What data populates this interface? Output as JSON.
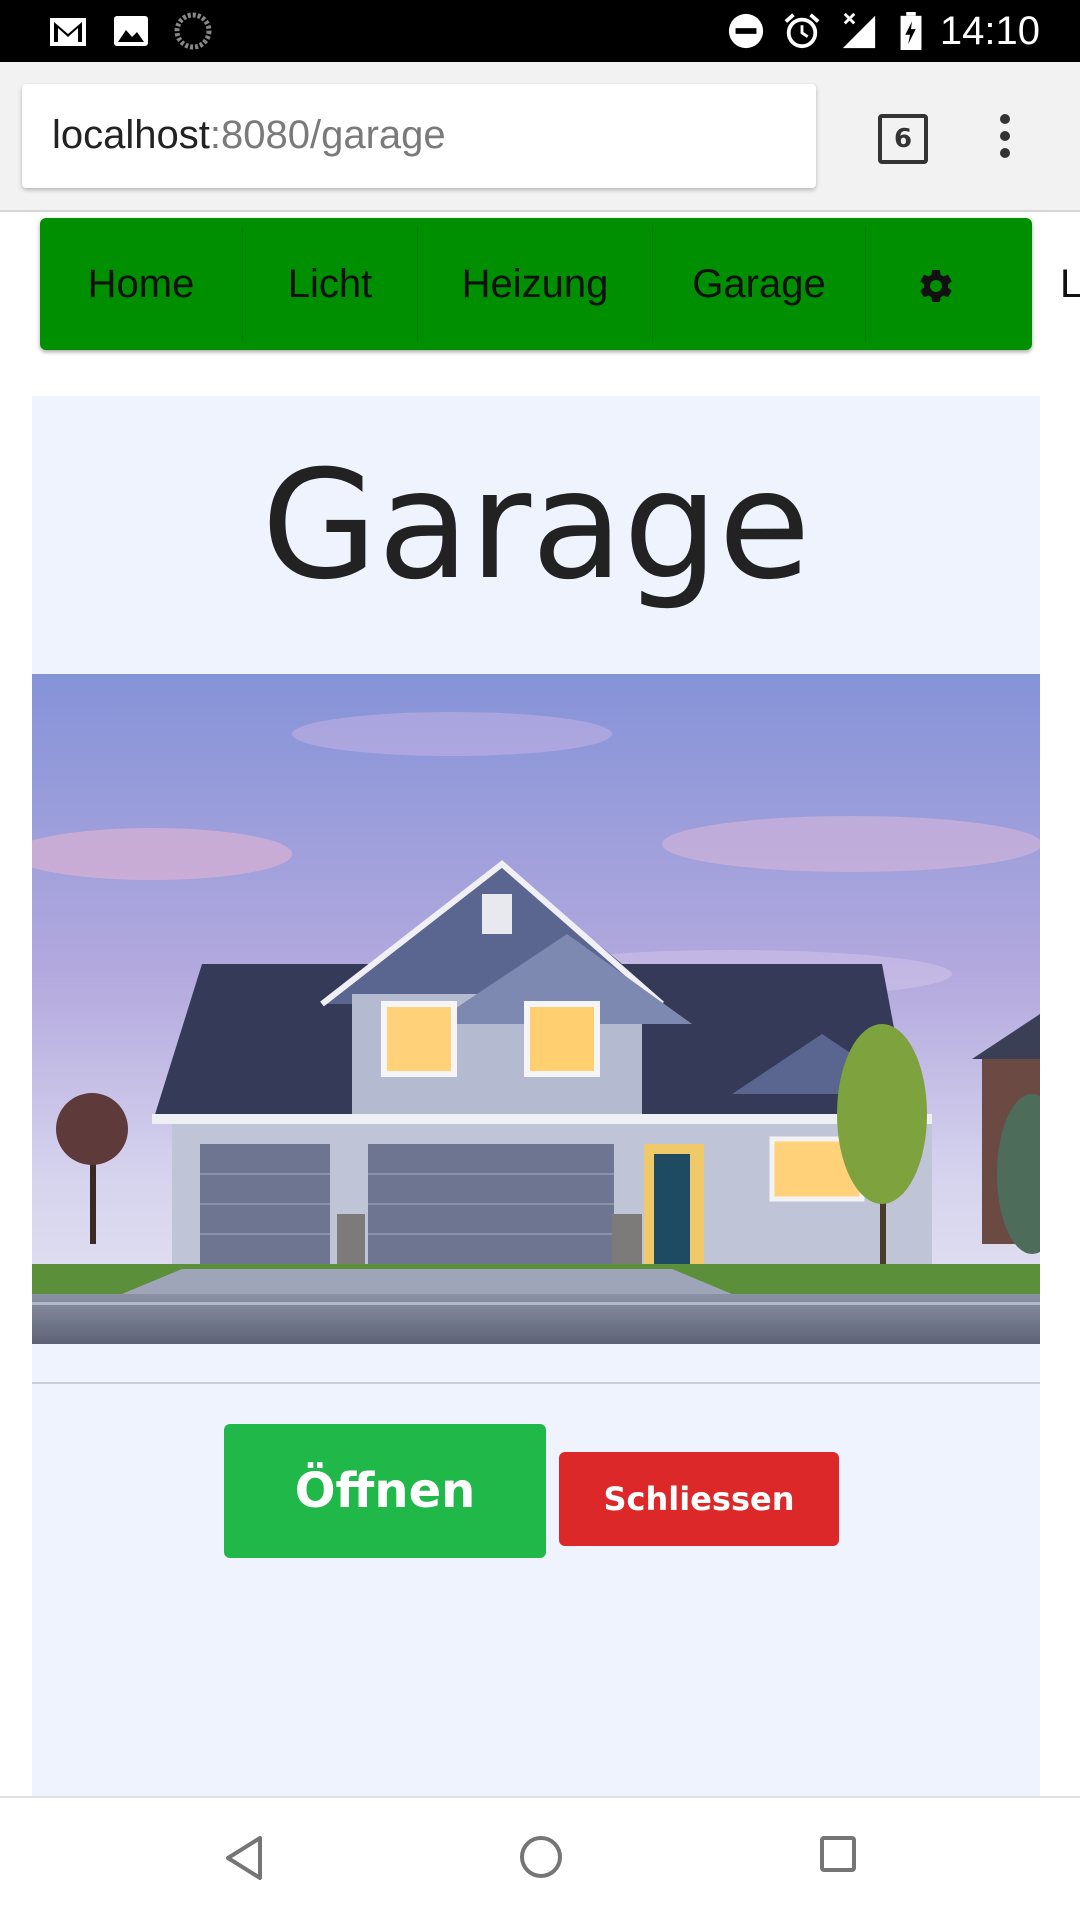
{
  "status_bar": {
    "time": "14:10",
    "icons": [
      "gmail-icon",
      "image-icon",
      "sync-icon",
      "dnd-icon",
      "alarm-icon",
      "signal-icon",
      "battery-icon"
    ]
  },
  "browser": {
    "url_host": "localhost",
    "url_path": ":8080/garage",
    "tab_count": "6"
  },
  "nav": {
    "items": [
      "Home",
      "Licht",
      "Heizung",
      "Garage"
    ],
    "overflow_text": "L",
    "color": "#008f00"
  },
  "page": {
    "title": "Garage",
    "open_label": "Öffnen",
    "close_label": "Schliessen"
  },
  "colors": {
    "open_button": "#21b84a",
    "close_button": "#dc2828",
    "card_bg": "#eff3fd"
  }
}
